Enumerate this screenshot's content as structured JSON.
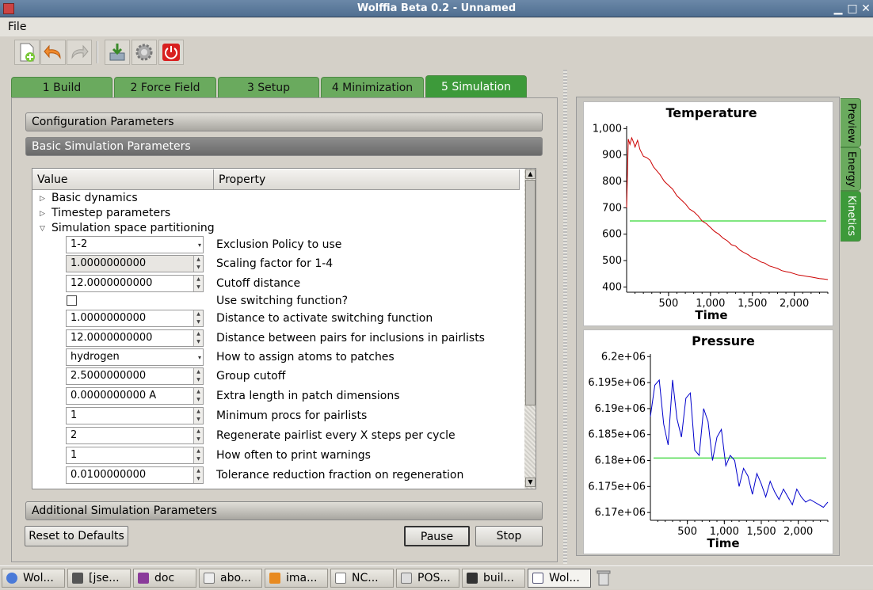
{
  "window": {
    "title": "Wolffia Beta 0.2 - Unnamed"
  },
  "menu": {
    "file": "File"
  },
  "toolbar": {
    "icons": [
      "new-file-icon",
      "undo-icon",
      "redo-icon",
      "save-icon",
      "settings-icon",
      "power-icon"
    ]
  },
  "tabs": [
    "1  Build",
    "2  Force Field",
    "3  Setup",
    "4  Minimization",
    "5  Simulation"
  ],
  "sections": {
    "config": "Configuration Parameters",
    "basic": "Basic Simulation Parameters",
    "additional": "Additional Simulation Parameters"
  },
  "tree": {
    "headers": {
      "value": "Value",
      "property": "Property"
    },
    "groups": [
      "Basic dynamics",
      "Timestep parameters",
      "Simulation space partitioning"
    ],
    "rows": [
      {
        "value": "1-2",
        "property": "Exclusion Policy to use"
      },
      {
        "value": "1.0000000000",
        "property": "Scaling factor for 1-4"
      },
      {
        "value": "12.0000000000",
        "property": "Cutoff distance"
      },
      {
        "value": "",
        "property": "Use switching function?"
      },
      {
        "value": "1.0000000000",
        "property": "Distance to activate switching function"
      },
      {
        "value": "12.0000000000",
        "property": "Distance between pairs for inclusions in pairlists"
      },
      {
        "value": "hydrogen",
        "property": "How to assign atoms to patches"
      },
      {
        "value": "2.5000000000",
        "property": "Group cutoff"
      },
      {
        "value": "0.0000000000 A",
        "property": "Extra length in patch dimensions"
      },
      {
        "value": "1",
        "property": "Minimum procs for pairlists"
      },
      {
        "value": "2",
        "property": "Regenerate pairlist every X steps per cycle"
      },
      {
        "value": "1",
        "property": "How often to print warnings"
      },
      {
        "value": "0.0100000000",
        "property": "Tolerance reduction fraction on regeneration"
      }
    ]
  },
  "buttons": {
    "reset": "Reset to Defaults",
    "pause": "Pause",
    "stop": "Stop"
  },
  "side_tabs": [
    "Preview",
    "Energy",
    "Kinetics"
  ],
  "colors": {
    "tab_green": "#6aaa5e",
    "tab_active": "#3d9a3a",
    "temp_line": "#cc0000",
    "pressure_line": "#0000cc",
    "ref_line": "#00cc00"
  },
  "chart_data": [
    {
      "type": "line",
      "title": "Temperature",
      "xlabel": "Time",
      "ylabel": "",
      "xticks": [
        "500",
        "1,000",
        "1,500",
        "2,000"
      ],
      "yticks": [
        "400",
        "500",
        "600",
        "700",
        "800",
        "900",
        "1,000"
      ],
      "xlim": [
        0,
        2400
      ],
      "ylim": [
        380,
        1010
      ],
      "grid": false,
      "series": [
        {
          "x": [
            0,
            20,
            40,
            60,
            80,
            100,
            130,
            160,
            200,
            240,
            280,
            320,
            360,
            400,
            450,
            500,
            550,
            600,
            650,
            700,
            750,
            800,
            850,
            900,
            950,
            1000,
            1050,
            1100,
            1150,
            1200,
            1250,
            1300,
            1350,
            1400,
            1450,
            1500,
            1550,
            1600,
            1650,
            1700,
            1750,
            1800,
            1850,
            1900,
            1950,
            2000,
            2050,
            2100,
            2150,
            2200,
            2250,
            2300,
            2350,
            2400
          ],
          "y": [
            700,
            960,
            940,
            965,
            950,
            930,
            955,
            920,
            895,
            890,
            880,
            855,
            840,
            825,
            800,
            785,
            770,
            745,
            730,
            715,
            695,
            685,
            670,
            650,
            640,
            625,
            610,
            600,
            585,
            575,
            560,
            555,
            540,
            530,
            522,
            510,
            505,
            495,
            490,
            480,
            475,
            470,
            462,
            458,
            455,
            450,
            445,
            443,
            440,
            438,
            435,
            432,
            430,
            428
          ]
        }
      ],
      "reference": 650
    },
    {
      "type": "line",
      "title": "Pressure",
      "xlabel": "Time",
      "ylabel": "",
      "xticks": [
        "500",
        "1,000",
        "1,500",
        "2,000"
      ],
      "yticks": [
        "6.17e+06",
        "6.175e+06",
        "6.18e+06",
        "6.185e+06",
        "6.19e+06",
        "6.195e+06",
        "6.2e+06"
      ],
      "xlim": [
        0,
        2400
      ],
      "ylim": [
        6168500,
        6200500
      ],
      "grid": false,
      "series": [
        {
          "x": [
            0,
            60,
            120,
            180,
            240,
            300,
            360,
            420,
            480,
            540,
            600,
            660,
            720,
            780,
            840,
            900,
            960,
            1020,
            1080,
            1140,
            1200,
            1260,
            1320,
            1380,
            1440,
            1500,
            1560,
            1620,
            1680,
            1740,
            1800,
            1860,
            1920,
            1980,
            2040,
            2100,
            2160,
            2220,
            2280,
            2340,
            2400
          ],
          "y": [
            6188500,
            6194500,
            6195500,
            6187000,
            6183000,
            6195500,
            6188000,
            6184500,
            6192000,
            6193000,
            6182000,
            6181000,
            6190000,
            6187500,
            6180000,
            6184500,
            6186000,
            6179000,
            6181000,
            6180000,
            6175000,
            6178500,
            6177000,
            6173500,
            6177500,
            6175500,
            6173000,
            6176000,
            6174000,
            6172500,
            6174500,
            6173000,
            6171500,
            6174500,
            6173000,
            6172000,
            6172500,
            6172000,
            6171500,
            6171000,
            6172000
          ]
        }
      ],
      "reference": 6180500
    }
  ],
  "taskbar": [
    "Wol...",
    "[jse...",
    "doc",
    "abo...",
    "ima...",
    "NC...",
    "POS...",
    "buil...",
    "Wol..."
  ]
}
